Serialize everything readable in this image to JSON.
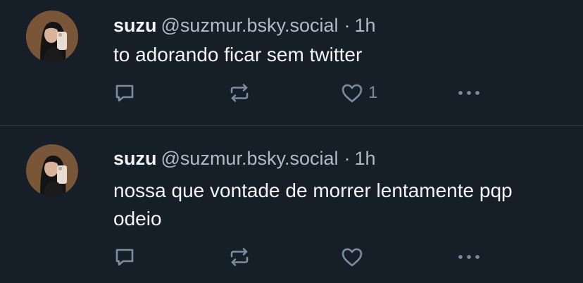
{
  "posts": [
    {
      "display_name": "suzu",
      "handle": "@suzmur.bsky.social",
      "separator": "·",
      "time": "1h",
      "text": "to adorando ficar sem twitter",
      "like_count": "1",
      "avatar_icon": "profile-photo"
    },
    {
      "display_name": "suzu",
      "handle": "@suzmur.bsky.social",
      "separator": "·",
      "time": "1h",
      "text": "nossa que vontade de morrer lentamente pqp odeio",
      "like_count": "",
      "avatar_icon": "profile-photo"
    }
  ],
  "icons": {
    "reply": "reply-icon",
    "repost": "repost-icon",
    "like": "heart-icon",
    "more": "more-options-icon"
  },
  "colors": {
    "background": "#161e27",
    "text": "#f1f3f5",
    "secondary_text": "#aebbc9",
    "icon": "#7b8da0",
    "divider": "#2e3a47"
  }
}
